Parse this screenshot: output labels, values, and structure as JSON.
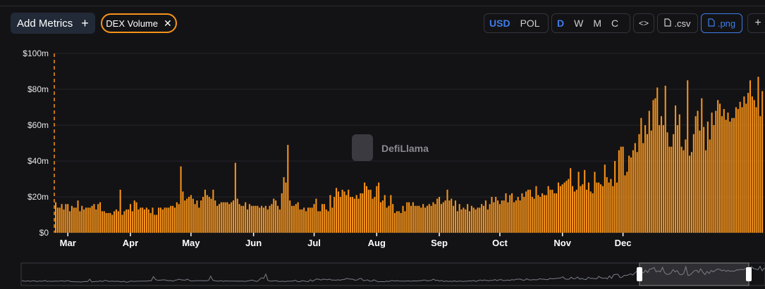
{
  "toolbar": {
    "add_metrics_label": "Add Metrics",
    "add_metrics_icon": "plus-icon",
    "metric_chip_label": "DEX Volume",
    "metric_chip_close_icon": "close-icon",
    "currency_options": [
      "USD",
      "POL"
    ],
    "currency_selected": "USD",
    "interval_options": [
      "D",
      "W",
      "M",
      "C"
    ],
    "interval_selected": "D",
    "embed_label": "<>",
    "csv_label": ".csv",
    "png_label": ".png",
    "more_label": "+",
    "accent_color": "#3f7de8"
  },
  "watermark": "DefiLlama",
  "chart_data": {
    "type": "bar",
    "series": [
      {
        "color": "#f7931a",
        "values": [
          17,
          14,
          14,
          16,
          13,
          16,
          16,
          12,
          15,
          14,
          14,
          18,
          12,
          15,
          13,
          14,
          14,
          14,
          15,
          16,
          13,
          16,
          17,
          12,
          12,
          11,
          11,
          11,
          10,
          12,
          13,
          12,
          24,
          10,
          12,
          13,
          13,
          16,
          12,
          18,
          17,
          13,
          14,
          14,
          13,
          14,
          13,
          11,
          14,
          10,
          10,
          14,
          14,
          13,
          14,
          14,
          14,
          15,
          15,
          14,
          17,
          16,
          37,
          23,
          18,
          19,
          20,
          21,
          19,
          16,
          18,
          14,
          18,
          20,
          24,
          21,
          20,
          19,
          24,
          18,
          15,
          16,
          17,
          17,
          17,
          17,
          16,
          17,
          18,
          39,
          19,
          16,
          15,
          15,
          17,
          13,
          16,
          15,
          15,
          15,
          15,
          14,
          15,
          14,
          15,
          13,
          15,
          16,
          19,
          18,
          15,
          13,
          22,
          31,
          28,
          49,
          18,
          15,
          15,
          16,
          17,
          13,
          13,
          14,
          12,
          14,
          14,
          14,
          16,
          19,
          12,
          12,
          16,
          16,
          13,
          12,
          21,
          14,
          20,
          25,
          23,
          20,
          24,
          23,
          21,
          24,
          20,
          20,
          19,
          21,
          19,
          22,
          22,
          28,
          26,
          24,
          24,
          19,
          20,
          26,
          28,
          17,
          18,
          21,
          14,
          15,
          21,
          16,
          11,
          12,
          12,
          11,
          15,
          12,
          17,
          17,
          15,
          17,
          15,
          15,
          15,
          14,
          16,
          14,
          15,
          16,
          15,
          17,
          16,
          19,
          20,
          16,
          17,
          18,
          24,
          18,
          19,
          15,
          18,
          12,
          16,
          13,
          14,
          13,
          16,
          12,
          15,
          14,
          13,
          14,
          14,
          16,
          15,
          18,
          13,
          16,
          20,
          17,
          20,
          18,
          16,
          18,
          18,
          22,
          17,
          21,
          22,
          17,
          18,
          20,
          18,
          22,
          20,
          23,
          24,
          24,
          20,
          19,
          26,
          21,
          20,
          22,
          21,
          21,
          26,
          24,
          24,
          22,
          22,
          28,
          26,
          27,
          28,
          29,
          30,
          36,
          26,
          23,
          24,
          34,
          26,
          27,
          35,
          24,
          28,
          23,
          22,
          34,
          28,
          28,
          27,
          26,
          38,
          31,
          28,
          30,
          26,
          40,
          28,
          46,
          48,
          48,
          32,
          34,
          43,
          42,
          46,
          50,
          45,
          55,
          64,
          50,
          60,
          55,
          68,
          57,
          74,
          75,
          81,
          60,
          65,
          60,
          82,
          56,
          48,
          48,
          55,
          71,
          60,
          66,
          48,
          46,
          52,
          85,
          43,
          45,
          55,
          65,
          68,
          57,
          75,
          59,
          46,
          62,
          52,
          67,
          60,
          68,
          74,
          72,
          65,
          69,
          63,
          67,
          62,
          64,
          64,
          70,
          69,
          73,
          70,
          76,
          72,
          78,
          85,
          76,
          74,
          70,
          87,
          65,
          79
        ]
      }
    ],
    "x_start": "2024-02-24",
    "x_tick_labels": [
      "Mar",
      "Apr",
      "May",
      "Jun",
      "Jul",
      "Aug",
      "Sep",
      "Oct",
      "Nov",
      "Dec"
    ],
    "y_tick_labels": [
      "$0",
      "$20m",
      "$40m",
      "$60m",
      "$80m",
      "$100m"
    ],
    "ylim": [
      0,
      100
    ],
    "grid": true
  }
}
